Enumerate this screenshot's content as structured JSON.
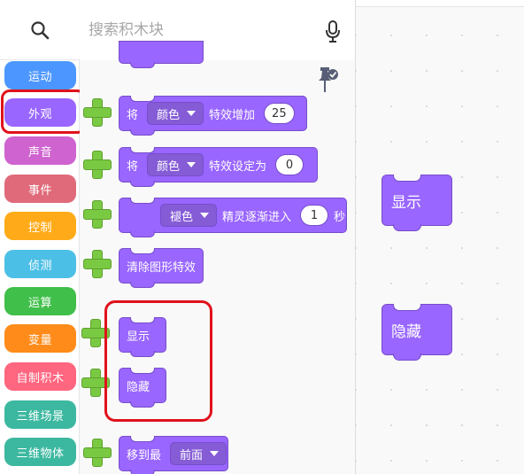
{
  "search": {
    "placeholder": "搜索积木块"
  },
  "categories": [
    {
      "label": "运动",
      "color": "#4c97ff"
    },
    {
      "label": "外观",
      "color": "#9966ff"
    },
    {
      "label": "声音",
      "color": "#cf63cf"
    },
    {
      "label": "事件",
      "color": "#e06a7a"
    },
    {
      "label": "控制",
      "color": "#ffab19"
    },
    {
      "label": "侦测",
      "color": "#4cbfe6"
    },
    {
      "label": "运算",
      "color": "#40bf4a"
    },
    {
      "label": "变量",
      "color": "#ff8c1a"
    },
    {
      "label": "自制积木",
      "color": "#ff6680"
    },
    {
      "label": "三维场景",
      "color": "#3cb8a0"
    },
    {
      "label": "三维物体",
      "color": "#3cb8a0"
    }
  ],
  "blocks": {
    "change_effect": {
      "prefix": "将",
      "effect": "颜色",
      "suffix": "特效增加",
      "value": "25"
    },
    "set_effect": {
      "prefix": "将",
      "effect": "颜色",
      "suffix": "特效设定为",
      "value": "0"
    },
    "fade_in": {
      "effect": "褪色",
      "suffix": "精灵逐渐进入",
      "value": "1",
      "unit": "秒"
    },
    "clear_effects": {
      "label": "清除图形特效"
    },
    "show": {
      "label": "显示"
    },
    "hide": {
      "label": "隐藏"
    },
    "go_to_layer": {
      "prefix": "移到最",
      "layer": "前面"
    }
  },
  "workspace": {
    "show_block": "显示",
    "hide_block": "隐藏"
  },
  "colors": {
    "looks": "#9966ff",
    "highlight": "#e0121c",
    "add_plus": "#7ac943"
  },
  "icons": [
    "search-icon",
    "microphone-icon",
    "pin-icon",
    "add-icon"
  ]
}
